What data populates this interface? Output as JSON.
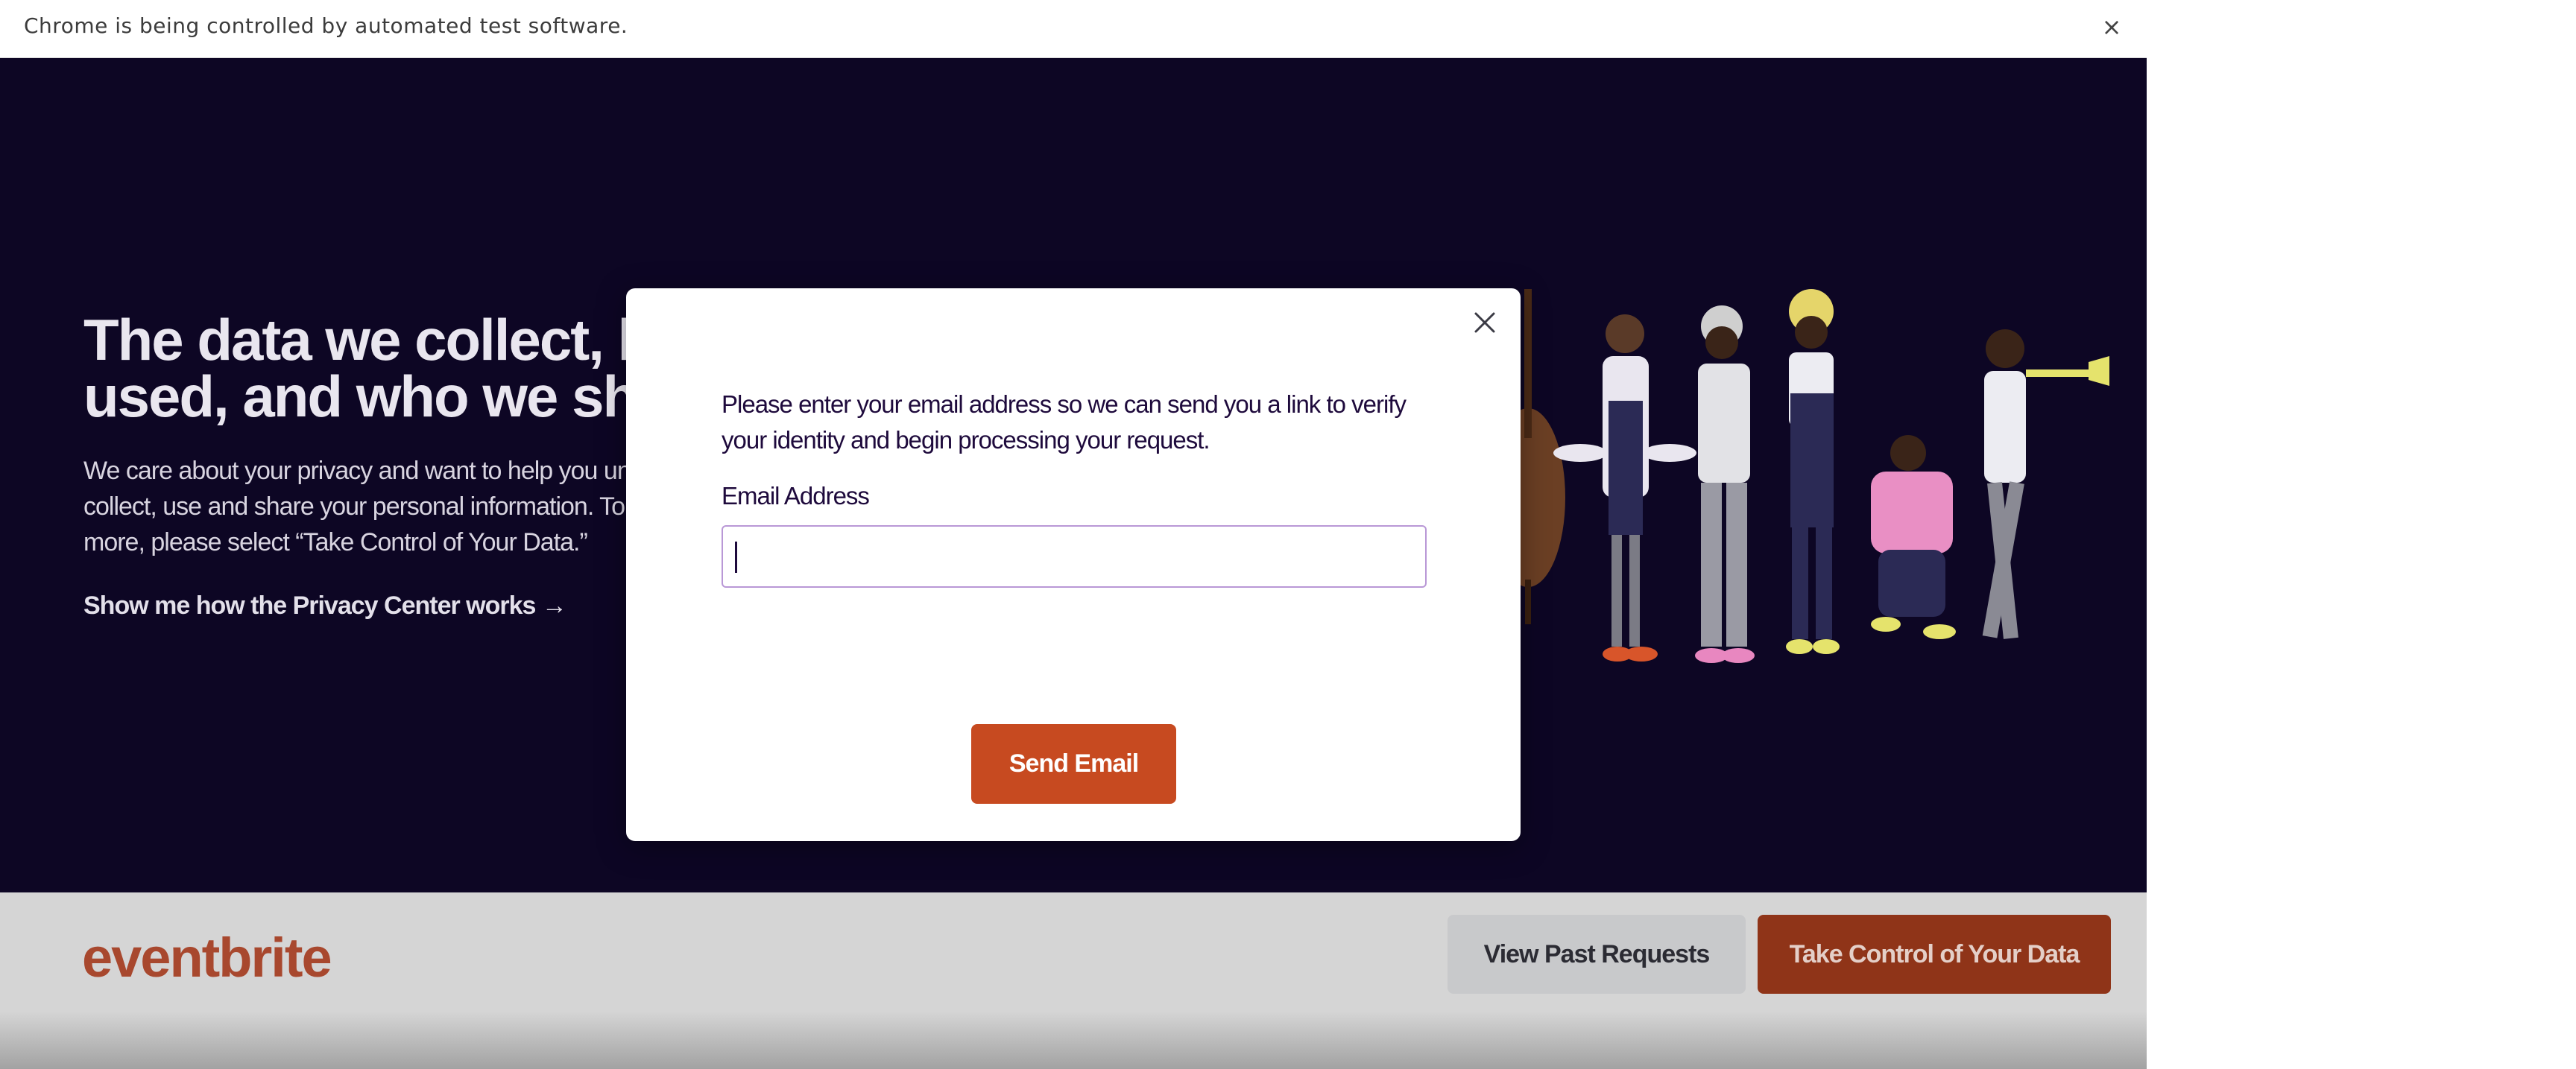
{
  "browser": {
    "infobar_text": "Chrome is being controlled by automated test software.",
    "close_glyph": "×"
  },
  "hero": {
    "title": "The data we collect, how it's used, and who we share it with",
    "description": "We care about your privacy and want to help you understand how we collect, use and share your personal information. To access, delete and more, please select “Take Control of Your Data.”",
    "link_text": "Show me how the Privacy Center works →"
  },
  "footer": {
    "logo_text": "eventbrite",
    "view_past_label": "View Past Requests",
    "take_control_label": "Take Control of Your Data"
  },
  "modal": {
    "message": "Please enter your email address so we can send you a link to verify your identity and begin processing your request.",
    "email_label": "Email Address",
    "email_value": "",
    "email_placeholder": "",
    "send_label": "Send Email"
  },
  "colors": {
    "hero_background": "#0d0624",
    "brand_orange": "#c74a20",
    "input_border": "#b998d6",
    "text_dark": "#1e0a3c"
  }
}
